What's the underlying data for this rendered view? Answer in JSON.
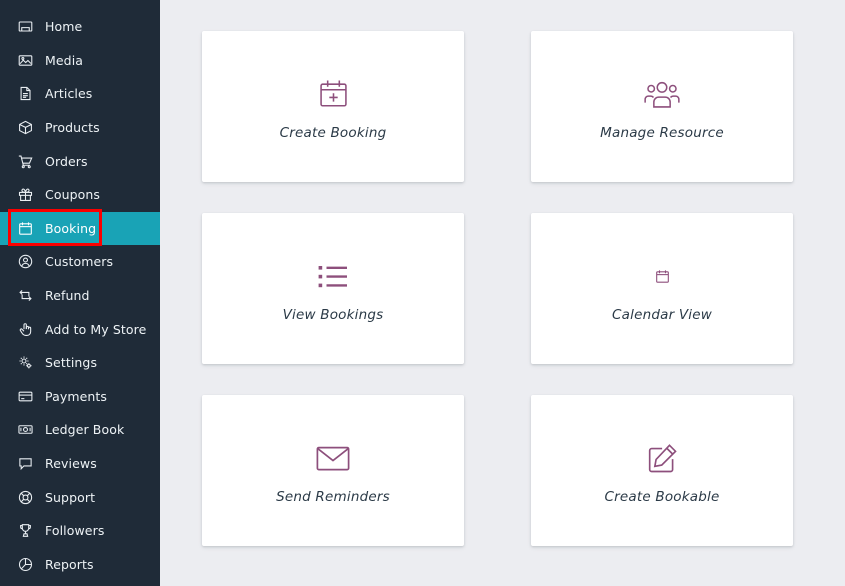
{
  "theme": {
    "sidebar_bg": "#1f2b38",
    "sidebar_active_bg": "#19a3b6",
    "main_bg": "#ecedf1",
    "card_bg": "#ffffff",
    "icon_accent": "#8d4f7c",
    "annotation_color": "#fb0000",
    "label_color": "#2b3a47"
  },
  "sidebar": {
    "items": [
      {
        "label": "Home",
        "icon": "home-icon",
        "active": false
      },
      {
        "label": "Media",
        "icon": "media-image-icon",
        "active": false
      },
      {
        "label": "Articles",
        "icon": "document-icon",
        "active": false
      },
      {
        "label": "Products",
        "icon": "box-icon",
        "active": false
      },
      {
        "label": "Orders",
        "icon": "shopping-cart-icon",
        "active": false
      },
      {
        "label": "Coupons",
        "icon": "gift-icon",
        "active": false
      },
      {
        "label": "Booking",
        "icon": "calendar-icon",
        "active": true
      },
      {
        "label": "Customers",
        "icon": "user-circle-icon",
        "active": false
      },
      {
        "label": "Refund",
        "icon": "refund-arrows-icon",
        "active": false
      },
      {
        "label": "Add to My Store",
        "icon": "pointing-hand-icon",
        "active": false
      },
      {
        "label": "Settings",
        "icon": "gears-icon",
        "active": false
      },
      {
        "label": "Payments",
        "icon": "credit-card-icon",
        "active": false
      },
      {
        "label": "Ledger Book",
        "icon": "banknote-icon",
        "active": false
      },
      {
        "label": "Reviews",
        "icon": "speech-bubble-icon",
        "active": false
      },
      {
        "label": "Support",
        "icon": "lifebuoy-icon",
        "active": false
      },
      {
        "label": "Followers",
        "icon": "trophy-icon",
        "active": false
      },
      {
        "label": "Reports",
        "icon": "pie-chart-icon",
        "active": false
      }
    ]
  },
  "main": {
    "cards": [
      {
        "label": "Create Booking",
        "icon": "calendar-plus-icon"
      },
      {
        "label": "Manage Resource",
        "icon": "users-group-icon"
      },
      {
        "label": "View Bookings",
        "icon": "bullet-list-icon"
      },
      {
        "label": "Calendar View",
        "icon": "calendar-icon"
      },
      {
        "label": "Send Reminders",
        "icon": "envelope-icon"
      },
      {
        "label": "Create Bookable",
        "icon": "edit-pencil-square-icon"
      }
    ]
  },
  "annotations": {
    "highlight_target": "Booking",
    "arrow_target": "Create Bookable"
  }
}
